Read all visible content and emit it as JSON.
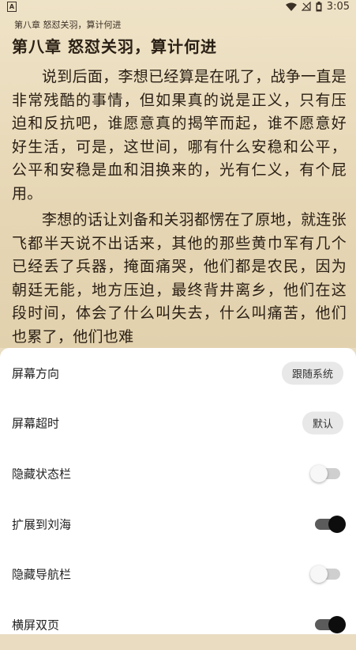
{
  "status_bar": {
    "app_badge": "A",
    "time": "3:05"
  },
  "reader": {
    "header": "第八章 怒怼关羽，算计何进",
    "chapter_title": "第八章 怒怼关羽，算计何进",
    "paragraphs": [
      "说到后面，李想已经算是在吼了，战争一直是非常残酷的事情，但如果真的说是正义，只有压迫和反抗吧，谁愿意真的揭竿而起，谁不愿意好好生活，可是，这世间，哪有什么安稳和公平，公平和安稳是血和泪换来的，光有仁义，有个屁用。",
      "李想的话让刘备和关羽都愣在了原地，就连张飞都半天说不出话来，其他的那些黄巾军有几个已经丢了兵器，掩面痛哭，他们都是农民，因为朝廷无能，地方压迫，最终背井离乡，他们在这段时间，体会了什么叫失去，什么叫痛苦，他们也累了，他们也难"
    ]
  },
  "settings": [
    {
      "label": "屏幕方向",
      "type": "pill",
      "value": "跟随系统"
    },
    {
      "label": "屏幕超时",
      "type": "pill",
      "value": "默认"
    },
    {
      "label": "隐藏状态栏",
      "type": "toggle",
      "on": false
    },
    {
      "label": "扩展到刘海",
      "type": "toggle",
      "on": true
    },
    {
      "label": "隐藏导航栏",
      "type": "toggle",
      "on": false
    },
    {
      "label": "横屏双页",
      "type": "toggle",
      "on": true
    }
  ]
}
